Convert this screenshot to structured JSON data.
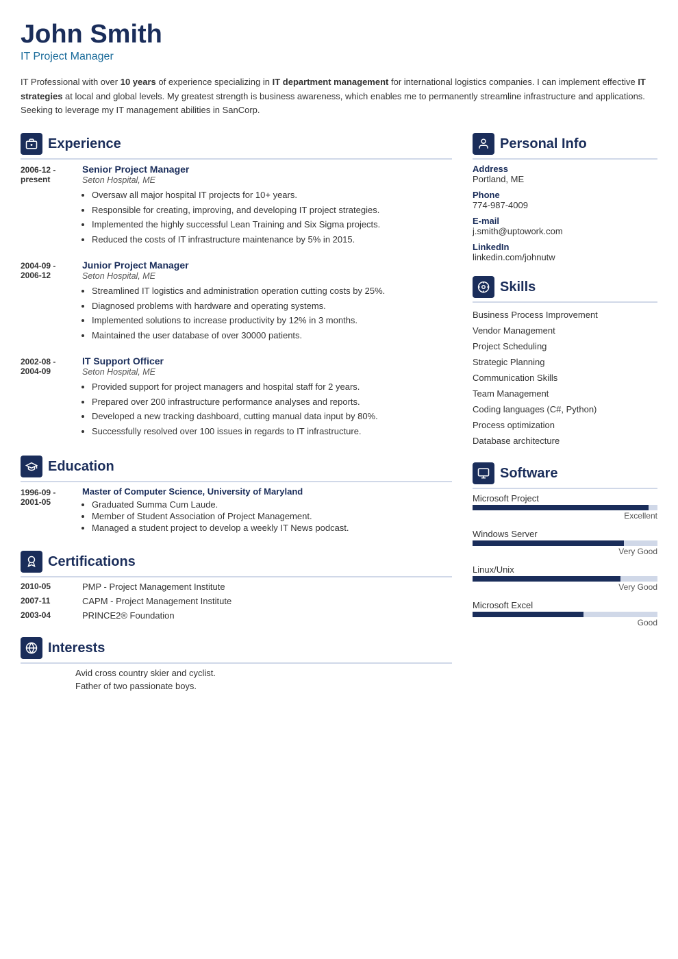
{
  "header": {
    "name": "John Smith",
    "title": "IT Project Manager"
  },
  "summary": {
    "text_parts": [
      {
        "text": "IT Professional with over ",
        "bold": false
      },
      {
        "text": "10 years",
        "bold": true
      },
      {
        "text": " of experience specializing in ",
        "bold": false
      },
      {
        "text": "IT department management",
        "bold": true
      },
      {
        "text": " for international logistics companies. I can implement effective ",
        "bold": false
      },
      {
        "text": "IT strategies",
        "bold": true
      },
      {
        "text": " at local and global levels. My greatest strength is business awareness, which enables me to permanently streamline infrastructure and applications. Seeking to leverage my IT management abilities in SanCorp.",
        "bold": false
      }
    ]
  },
  "experience": {
    "section_title": "Experience",
    "entries": [
      {
        "date": "2006-12 - present",
        "job_title": "Senior Project Manager",
        "company": "Seton Hospital, ME",
        "bullets": [
          "Oversaw all major hospital IT projects for 10+ years.",
          "Responsible for creating, improving, and developing IT project strategies.",
          "Implemented the highly successful Lean Training and Six Sigma projects.",
          "Reduced the costs of IT infrastructure maintenance by 5% in 2015."
        ]
      },
      {
        "date": "2004-09 - 2006-12",
        "job_title": "Junior Project Manager",
        "company": "Seton Hospital, ME",
        "bullets": [
          "Streamlined IT logistics and administration operation cutting costs by 25%.",
          "Diagnosed problems with hardware and operating systems.",
          "Implemented solutions to increase productivity by 12% in 3 months.",
          "Maintained the user database of over 30000 patients."
        ]
      },
      {
        "date": "2002-08 - 2004-09",
        "job_title": "IT Support Officer",
        "company": "Seton Hospital, ME",
        "bullets": [
          "Provided support for project managers and hospital staff for 2 years.",
          "Prepared over 200 infrastructure performance analyses and reports.",
          "Developed a new tracking dashboard, cutting manual data input by 80%.",
          "Successfully resolved over 100 issues in regards to IT infrastructure."
        ]
      }
    ]
  },
  "education": {
    "section_title": "Education",
    "entries": [
      {
        "date": "1996-09 - 2001-05",
        "degree": "Master of Computer Science, University of Maryland",
        "bullets": [
          "Graduated Summa Cum Laude.",
          "Member of Student Association of Project Management.",
          "Managed a student project to develop a weekly IT News podcast."
        ]
      }
    ]
  },
  "certifications": {
    "section_title": "Certifications",
    "entries": [
      {
        "date": "2010-05",
        "name": "PMP - Project Management Institute"
      },
      {
        "date": "2007-11",
        "name": "CAPM - Project Management Institute"
      },
      {
        "date": "2003-04",
        "name": "PRINCE2® Foundation"
      }
    ]
  },
  "interests": {
    "section_title": "Interests",
    "items": [
      "Avid cross country skier and cyclist.",
      "Father of two passionate boys."
    ]
  },
  "personal_info": {
    "section_title": "Personal Info",
    "items": [
      {
        "label": "Address",
        "value": "Portland, ME"
      },
      {
        "label": "Phone",
        "value": "774-987-4009"
      },
      {
        "label": "E-mail",
        "value": "j.smith@uptowork.com"
      },
      {
        "label": "LinkedIn",
        "value": "linkedin.com/johnutw"
      }
    ]
  },
  "skills": {
    "section_title": "Skills",
    "items": [
      "Business Process Improvement",
      "Vendor Management",
      "Project Scheduling",
      "Strategic Planning",
      "Communication Skills",
      "Team Management",
      "Coding languages (C#, Python)",
      "Process optimization",
      "Database architecture"
    ]
  },
  "software": {
    "section_title": "Software",
    "items": [
      {
        "name": "Microsoft Project",
        "percent": 95,
        "label": "Excellent"
      },
      {
        "name": "Windows Server",
        "percent": 82,
        "label": "Very Good"
      },
      {
        "name": "Linux/Unix",
        "percent": 80,
        "label": "Very Good"
      },
      {
        "name": "Microsoft Excel",
        "percent": 65,
        "label": "Good"
      }
    ]
  },
  "icons": {
    "experience": "📋",
    "education": "🎓",
    "certifications": "🏅",
    "interests": "🌐",
    "personal_info": "👤",
    "skills": "⚙️",
    "software": "🖥️"
  },
  "colors": {
    "primary": "#1a2d5a",
    "accent": "#1a6b9a",
    "border": "#d0d8e8",
    "bar_bg": "#d0d8e8",
    "bar_fill": "#1a2d5a"
  }
}
